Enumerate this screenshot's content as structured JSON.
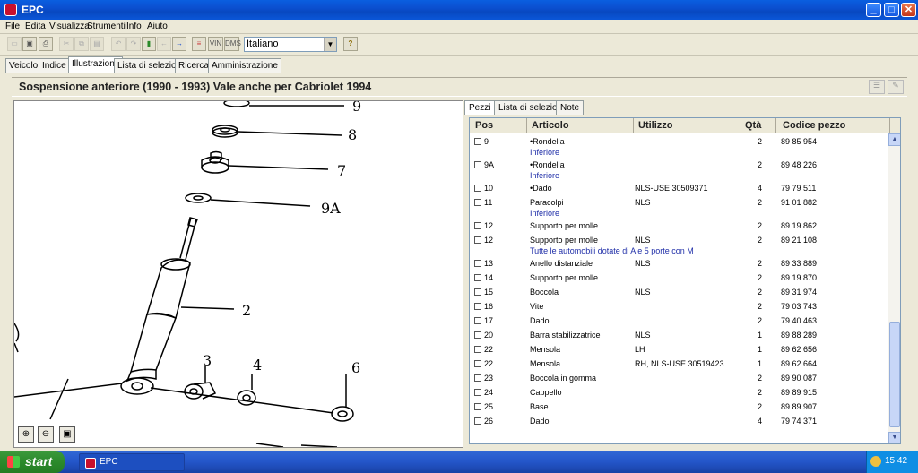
{
  "window": {
    "title": "EPC"
  },
  "menu": [
    "File",
    "Edita",
    "Visualizza",
    "Strumenti",
    "Info",
    "Aiuto"
  ],
  "toolbar": {
    "vin_label": "VIN",
    "dms_label": "DMS",
    "language": "Italiano",
    "help_glyph": "?"
  },
  "tabs_top": [
    "Veicolo",
    "Indice",
    "Illustrazione",
    "Lista di selezione",
    "Ricerca",
    "Amministrazione"
  ],
  "header": {
    "title": "Sospensione anteriore   (1990 - 1993)   Vale anche per Cabriolet 1994"
  },
  "diagram_labels": [
    "9",
    "8",
    "7",
    "9A",
    "2",
    "3",
    "4",
    "6"
  ],
  "right_tabs": [
    "Pezzi",
    "Lista di selezione",
    "Note"
  ],
  "grid": {
    "columns": [
      "Pos",
      "Articolo",
      "Utilizzo",
      "Qtà",
      "Codice pezzo"
    ],
    "rows": [
      {
        "pos": "9",
        "articolo": "•Rondella",
        "utilizzo": "",
        "qta": "2",
        "codice": "89 85 954",
        "note": "Inferiore"
      },
      {
        "pos": "9A",
        "articolo": "•Rondella",
        "utilizzo": "",
        "qta": "2",
        "codice": "89 48 226",
        "note": "Inferiore"
      },
      {
        "pos": "10",
        "articolo": "•Dado",
        "utilizzo": "NLS-USE 30509371",
        "qta": "4",
        "codice": "79 79 511",
        "note": ""
      },
      {
        "pos": "11",
        "articolo": "Paracolpi",
        "utilizzo": "NLS",
        "qta": "2",
        "codice": "91 01 882",
        "note": "Inferiore"
      },
      {
        "pos": "12",
        "articolo": "Supporto per molle",
        "utilizzo": "",
        "qta": "2",
        "codice": "89 19 862",
        "note": ""
      },
      {
        "pos": "12",
        "articolo": "Supporto per molle",
        "utilizzo": "NLS",
        "qta": "2",
        "codice": "89 21 108",
        "note": "Tutte le automobili dotate di A e 5 porte con M"
      },
      {
        "pos": "13",
        "articolo": "Anello distanziale",
        "utilizzo": "NLS",
        "qta": "2",
        "codice": "89 33 889",
        "note": ""
      },
      {
        "pos": "14",
        "articolo": "Supporto per molle",
        "utilizzo": "",
        "qta": "2",
        "codice": "89 19 870",
        "note": ""
      },
      {
        "pos": "15",
        "articolo": "Boccola",
        "utilizzo": "NLS",
        "qta": "2",
        "codice": "89 31 974",
        "note": ""
      },
      {
        "pos": "16",
        "articolo": "Vite",
        "utilizzo": "",
        "qta": "2",
        "codice": "79 03 743",
        "note": ""
      },
      {
        "pos": "17",
        "articolo": "Dado",
        "utilizzo": "",
        "qta": "2",
        "codice": "79 40 463",
        "note": ""
      },
      {
        "pos": "20",
        "articolo": "Barra stabilizzatrice",
        "utilizzo": "NLS",
        "qta": "1",
        "codice": "89 88 289",
        "note": ""
      },
      {
        "pos": "22",
        "articolo": "Mensola",
        "utilizzo": "LH",
        "qta": "1",
        "codice": "89 62 656",
        "note": ""
      },
      {
        "pos": "22",
        "articolo": "Mensola",
        "utilizzo": "RH, NLS-USE 30519423",
        "qta": "1",
        "codice": "89 62 664",
        "note": ""
      },
      {
        "pos": "23",
        "articolo": "Boccola in gomma",
        "utilizzo": "",
        "qta": "2",
        "codice": "89 90 087",
        "note": ""
      },
      {
        "pos": "24",
        "articolo": "Cappello",
        "utilizzo": "",
        "qta": "2",
        "codice": "89 89 915",
        "note": ""
      },
      {
        "pos": "25",
        "articolo": "Base",
        "utilizzo": "",
        "qta": "2",
        "codice": "89 89 907",
        "note": ""
      },
      {
        "pos": "26",
        "articolo": "Dado",
        "utilizzo": "",
        "qta": "4",
        "codice": "79 74 371",
        "note": ""
      }
    ]
  },
  "taskbar": {
    "start_label": "start",
    "task_label": "EPC",
    "clock": "15.42"
  }
}
